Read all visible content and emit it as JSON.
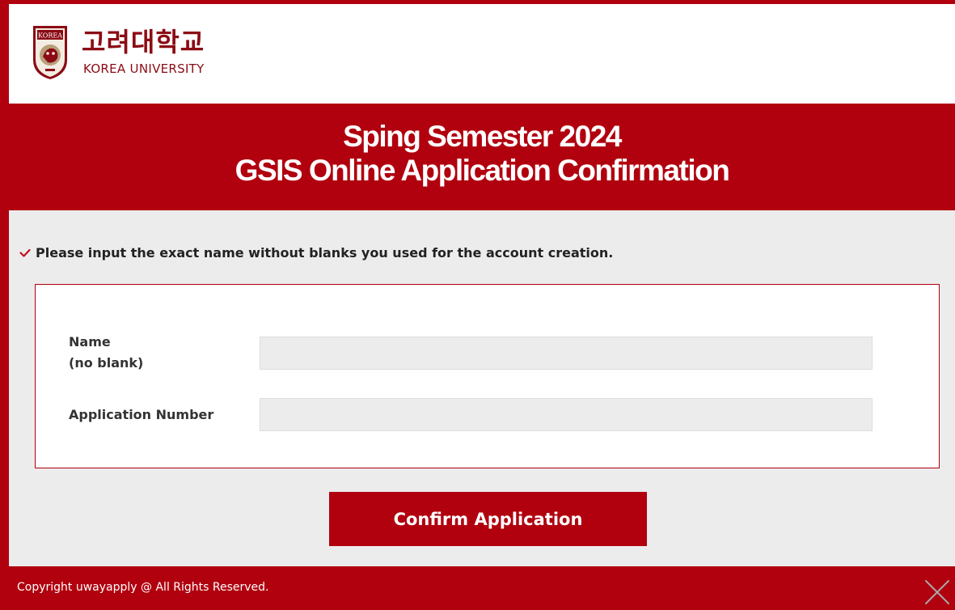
{
  "logo": {
    "crest_text": "KOREA",
    "korean_name": "고려대학교",
    "english_name": "KOREA UNIVERSITY"
  },
  "banner": {
    "line1": "Sping Semester 2024",
    "line2": "GSIS Online Application Confirmation"
  },
  "notice": {
    "icon": "check-icon",
    "text": "Please input the exact name without blanks you used for the account creation."
  },
  "form": {
    "name_label_line1": "Name",
    "name_label_line2": "(no blank)",
    "name_value": "",
    "appnum_label": "Application Number",
    "appnum_value": ""
  },
  "button": {
    "confirm_label": "Confirm Application"
  },
  "footer": {
    "copyright": "Copyright uwayapply @ All Rights Reserved.",
    "close_icon": "close-icon"
  },
  "colors": {
    "brand_red": "#b1000e",
    "logo_red": "#8b0b14",
    "panel_gray": "#ececec"
  }
}
